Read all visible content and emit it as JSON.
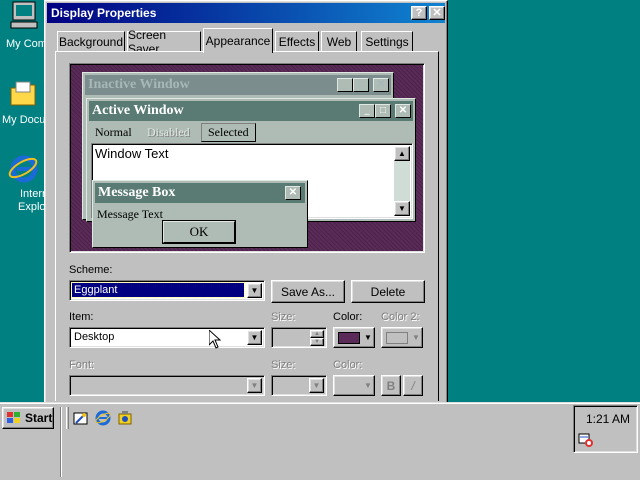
{
  "desktop": {
    "icons": [
      {
        "name": "my-computer",
        "label": "My Com"
      },
      {
        "name": "my-documents",
        "label": "My Docu"
      },
      {
        "name": "internet-explorer",
        "label1": "Intern",
        "label2": "Explo"
      }
    ]
  },
  "window": {
    "title": "Display Properties",
    "help_btn": "?",
    "close_btn": "✕",
    "tabs": [
      "Background",
      "Screen Saver",
      "Appearance",
      "Effects",
      "Web",
      "Settings"
    ],
    "active_tab": "Appearance"
  },
  "preview": {
    "inactive_title": "Inactive Window",
    "active_title": "Active Window",
    "menu": [
      "Normal",
      "Disabled",
      "Selected"
    ],
    "window_text": "Window Text",
    "msgbox_title": "Message Box",
    "msgbox_text": "Message Text",
    "ok_label": "OK"
  },
  "scheme": {
    "label": "Scheme:",
    "value": "Eggplant",
    "save_as": "Save As...",
    "delete": "Delete"
  },
  "item": {
    "label": "Item:",
    "value": "Desktop",
    "size_label": "Size:",
    "color_label": "Color:",
    "color2_label": "Color 2:",
    "color_value": "#5a2a58"
  },
  "font": {
    "label": "Font:",
    "size_label": "Size:",
    "color_label": "Color:",
    "bold": "B",
    "italic": "/"
  },
  "taskbar": {
    "start_label": "Start",
    "clock": "1:21 AM"
  }
}
